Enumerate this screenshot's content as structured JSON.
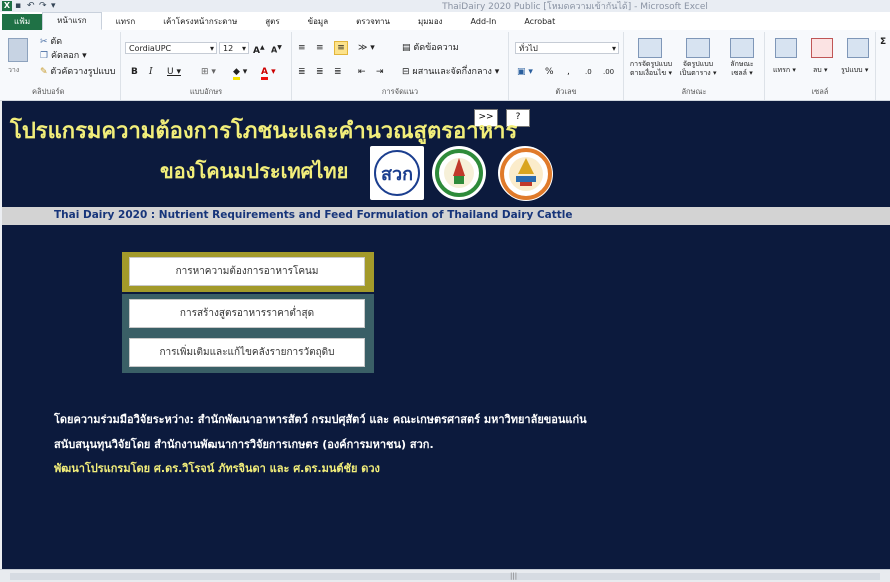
{
  "window": {
    "title": "ThaiDairy 2020 Public  [โหมดความเข้ากันได้] - Microsoft Excel"
  },
  "ribbon": {
    "tabs": [
      "แฟ้ม",
      "หน้าแรก",
      "แทรก",
      "เค้าโครงหน้ากระดาษ",
      "สูตร",
      "ข้อมูล",
      "ตรวจทาน",
      "มุมมอง",
      "Add-In",
      "Acrobat"
    ],
    "active_tab": "หน้าแรก",
    "clipboard": {
      "paste_label": "วาง",
      "cut_label": "ตัด",
      "copy_label": "คัดลอก",
      "format_painter_label": "ตัวคัดวางรูปแบบ",
      "group_label": "คลิปบอร์ด"
    },
    "font": {
      "font_name": "CordiaUPC",
      "font_size": "12",
      "group_label": "แบบอักษร"
    },
    "alignment": {
      "wrap_text_label": "ตัดข้อความ",
      "merge_center_label": "ผสานและจัดกึ่งกลาง",
      "group_label": "การจัดแนว"
    },
    "number": {
      "format_value": "ทั่วไป",
      "percent_label": "%",
      "comma_label": ",",
      "group_label": "ตัวเลข"
    },
    "styles": {
      "conditional_label_1": "การจัดรูปแบบ",
      "conditional_label_2": "ตามเงื่อนไข",
      "table_label_1": "จัดรูปแบบ",
      "table_label_2": "เป็นตาราง",
      "cell_styles_label_1": "ลักษณะ",
      "cell_styles_label_2": "เซลล์",
      "group_label": "ลักษณะ"
    },
    "cells": {
      "insert_label": "แทรก",
      "delete_label": "ลบ",
      "format_label": "รูปแบบ",
      "group_label": "เซลล์"
    }
  },
  "sheet": {
    "nav_next": ">>",
    "help": "?",
    "title_line1": "โปรแกรมความต้องการโภชนะและคำนวณสูตรอาหาร",
    "title_line2": "ของโคนมประเทศไทย",
    "logos": [
      "สวก",
      "institution-seal-green",
      "institution-seal-orange"
    ],
    "logo_a_text": "สวก",
    "english_title": "Thai Dairy 2020 : Nutrient Requirements and Feed Formulation of Thailand Dairy Cattle",
    "menu": [
      {
        "label": "การหาความต้องการอาหารโคนม"
      },
      {
        "label": "การสร้างสูตรอาหารราคาต่ำสุด"
      },
      {
        "label": "การเพิ่มเติมและแก้ไขคลังรายการวัตถุดิบ"
      }
    ],
    "credits": [
      "โดยความร่วมมือวิจัยระหว่าง: สำนักพัฒนาอาหารสัตว์ กรมปศุสัตว์ และ คณะเกษตรศาสตร์ มหาวิทยาลัยขอนแก่น",
      "สนับสนุนทุนวิจัยโดย สำนักงานพัฒนาการวิจัยการเกษตร (องค์การมหาชน) สวก.",
      "พัฒนาโปรแกรมโดย ศ.ดร.วิโรจน์ ภัทรจินดา และ ศ.ดร.มนต์ชัย ดวง"
    ]
  },
  "colors": {
    "sheet_bg": "#0c1a3d",
    "title_yellow": "#f2ee7a",
    "english_title_blue": "#17357a",
    "excel_green": "#1f7145"
  }
}
